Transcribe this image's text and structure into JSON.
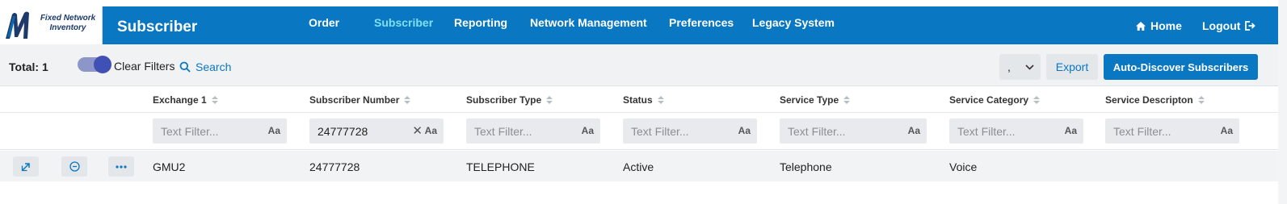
{
  "brand": {
    "logo_text_line1": "Fixed Network",
    "logo_text_line2": "Inventory"
  },
  "header": {
    "title": "Subscriber",
    "nav": [
      {
        "label": "Order",
        "active": false
      },
      {
        "label": "Subscriber",
        "active": true
      },
      {
        "label": "Reporting",
        "active": false
      },
      {
        "label": "Network Management",
        "active": false
      },
      {
        "label": "Preferences",
        "active": false
      },
      {
        "label": "Legacy System",
        "active": false
      }
    ],
    "home_label": "Home",
    "logout_label": "Logout",
    "colors": {
      "bar": "#0a77c2",
      "active_tab": "#7fe0f5"
    }
  },
  "toolbar": {
    "total_label": "Total: 1",
    "filters_toggle_on": true,
    "clear_filters_label": "Clear Filters",
    "search_label": "Search",
    "dropdown_value": ",",
    "export_label": "Export",
    "auto_discover_label": "Auto-Discover Subscribers"
  },
  "grid": {
    "columns": [
      "Exchange 1",
      "Subscriber Number",
      "Subscriber Type",
      "Status",
      "Service Type",
      "Service Category",
      "Service Descripton"
    ],
    "filter_placeholder": "Text Filter...",
    "filter_case_label": "Aa",
    "filters": [
      "",
      "24777728",
      "",
      "",
      "",
      "",
      ""
    ],
    "rows": [
      {
        "cells": [
          "GMU2",
          "24777728",
          "TELEPHONE",
          "Active",
          "Telephone",
          "Voice",
          ""
        ]
      }
    ],
    "row_actions": [
      "external-link-icon",
      "more-circle-icon",
      "more-dots-icon"
    ]
  }
}
